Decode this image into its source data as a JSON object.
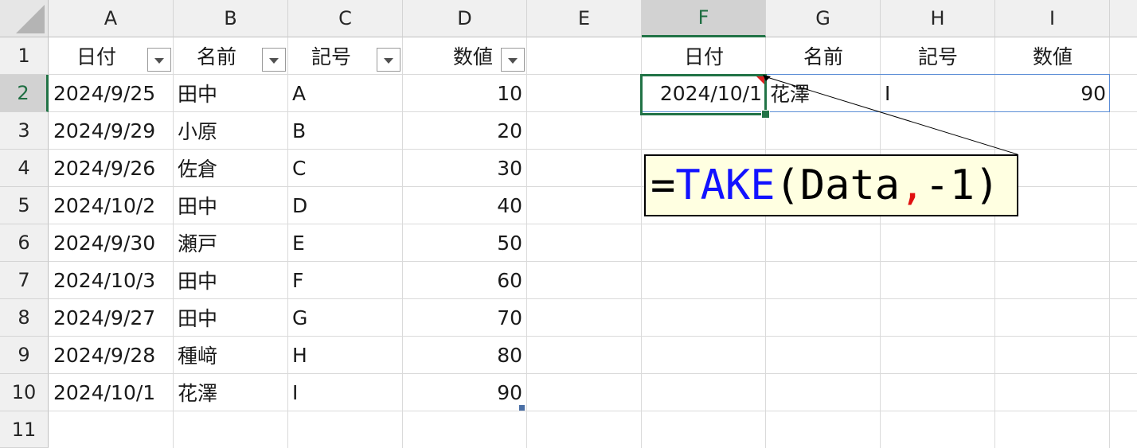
{
  "columns": [
    "A",
    "B",
    "C",
    "D",
    "E",
    "F",
    "G",
    "H",
    "I"
  ],
  "rows": [
    "1",
    "2",
    "3",
    "4",
    "5",
    "6",
    "7",
    "8",
    "9",
    "10",
    "11"
  ],
  "table": {
    "headers": [
      "日付",
      "名前",
      "記号",
      "数値"
    ],
    "rows": [
      [
        "2024/9/25",
        "田中",
        "A",
        "10"
      ],
      [
        "2024/9/29",
        "小原",
        "B",
        "20"
      ],
      [
        "2024/9/26",
        "佐倉",
        "C",
        "30"
      ],
      [
        "2024/10/2",
        "田中",
        "D",
        "40"
      ],
      [
        "2024/9/30",
        "瀬戸",
        "E",
        "50"
      ],
      [
        "2024/10/3",
        "田中",
        "F",
        "60"
      ],
      [
        "2024/9/27",
        "田中",
        "G",
        "70"
      ],
      [
        "2024/9/28",
        "種﨑",
        "H",
        "80"
      ],
      [
        "2024/10/1",
        "花澤",
        "I",
        "90"
      ]
    ]
  },
  "result": {
    "headers": [
      "日付",
      "名前",
      "記号",
      "数値"
    ],
    "row": [
      "2024/10/1",
      "花澤",
      "I",
      "90"
    ]
  },
  "formula": {
    "equals": "=",
    "function": "TAKE",
    "open_paren": "(",
    "arg1": "Data",
    "comma": ",",
    "arg2": "-1",
    "close_paren": ")"
  },
  "colors": {
    "selection": "#217346",
    "function_text": "#1212ff",
    "comma_text": "#e01010",
    "callout_bg": "#ffffe1"
  }
}
